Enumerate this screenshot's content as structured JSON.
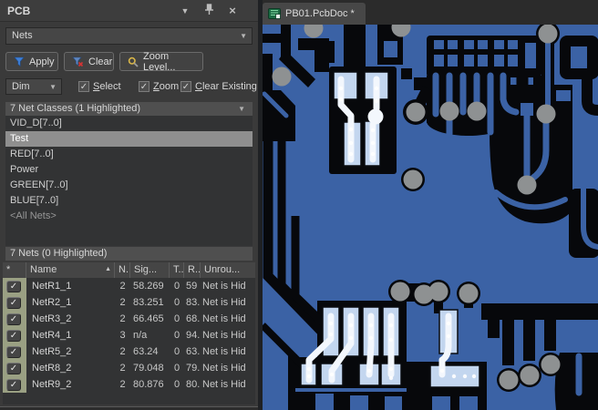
{
  "icons": {
    "dropdown": "▼",
    "sort_asc": "▲",
    "close": "×",
    "check": "✓"
  },
  "panel": {
    "title": "PCB",
    "mode_select": {
      "value": "Nets"
    },
    "toolbar": {
      "apply": "Apply",
      "clear": "Clear",
      "zoom_level": "Zoom Level..."
    },
    "filter_row": {
      "dim": "Dim",
      "select": "Select",
      "zoom": "Zoom",
      "clear_existing": "Clear Existing"
    },
    "classes": {
      "header": "7 Net Classes (1 Highlighted)",
      "selected": "Test",
      "items": [
        "VID_D[7..0]",
        "Test",
        "RED[7..0]",
        "Power",
        "GREEN[7..0]",
        "BLUE[7..0]",
        "<All Nets>"
      ]
    },
    "nets": {
      "header": "7 Nets (0 Highlighted)",
      "columns": {
        "star": "*",
        "name": "Name",
        "nodes": "N..",
        "signal": "Sig...",
        "t": "T...",
        "r": "R...",
        "unrouted": "Unrou..."
      },
      "rows": [
        {
          "checked": true,
          "name": "NetR1_1",
          "nodes": "2",
          "signal": "58.269",
          "t": "0",
          "r": "59",
          "unrouted": "Net is Hid"
        },
        {
          "checked": true,
          "name": "NetR2_1",
          "nodes": "2",
          "signal": "83.251",
          "t": "0",
          "r": "83.",
          "unrouted": "Net is Hid"
        },
        {
          "checked": true,
          "name": "NetR3_2",
          "nodes": "2",
          "signal": "66.465",
          "t": "0",
          "r": "68.",
          "unrouted": "Net is Hid"
        },
        {
          "checked": true,
          "name": "NetR4_1",
          "nodes": "3",
          "signal": "n/a",
          "t": "0",
          "r": "94.",
          "unrouted": "Net is Hid"
        },
        {
          "checked": true,
          "name": "NetR5_2",
          "nodes": "2",
          "signal": "63.24",
          "t": "0",
          "r": "63.",
          "unrouted": "Net is Hid"
        },
        {
          "checked": true,
          "name": "NetR8_2",
          "nodes": "2",
          "signal": "79.048",
          "t": "0",
          "r": "79.",
          "unrouted": "Net is Hid"
        },
        {
          "checked": true,
          "name": "NetR9_2",
          "nodes": "2",
          "signal": "80.876",
          "t": "0",
          "r": "80.",
          "unrouted": "Net is Hid"
        }
      ]
    }
  },
  "editor": {
    "tab_title": "PB01.PcbDoc *",
    "colors": {
      "copper_pour": "#3b62a5",
      "clearance": "#07080b",
      "highlight_pad": "#c3d6ef",
      "highlight_trace": "#f3f7fd",
      "via": "#8e9192"
    }
  }
}
